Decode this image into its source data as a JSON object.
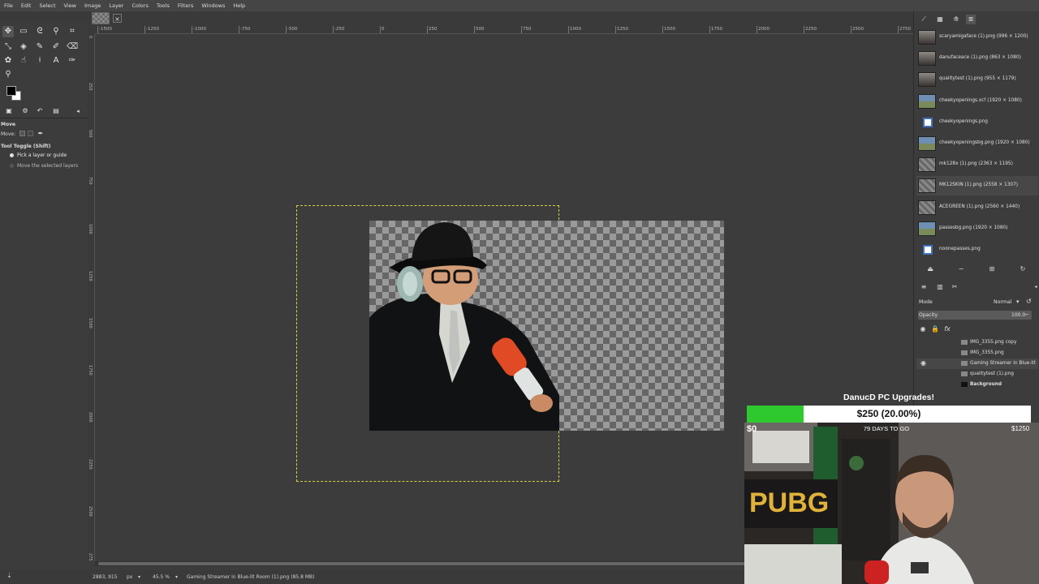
{
  "menu": [
    "File",
    "Edit",
    "Select",
    "View",
    "Image",
    "Layer",
    "Colors",
    "Tools",
    "Filters",
    "Windows",
    "Help"
  ],
  "tool_options": {
    "title": "Move",
    "move_label": "Move:",
    "toggle_label": "Tool Toggle  (Shift)",
    "opt1": "Pick a layer or guide",
    "opt2": "Move the selected layers"
  },
  "ruler": {
    "top_ticks": [
      "-1500",
      "-1250",
      "-1000",
      "-750",
      "-500",
      "-250",
      "0",
      "250",
      "500",
      "750",
      "1000",
      "1250",
      "1500",
      "1750",
      "2000",
      "2250",
      "2500",
      "2750"
    ],
    "left_ticks": [
      "0",
      "250",
      "500",
      "750",
      "1000",
      "1250",
      "1500",
      "1750",
      "2000",
      "2250",
      "2500",
      "2750"
    ]
  },
  "status": {
    "coords": "2883, 915",
    "unit": "px",
    "zoom": "45.5 %",
    "message": "Gaming Streamer in Blue-lit Room (1).png (85.8 MB)"
  },
  "images": [
    {
      "name": "scaryamigaface (1).png (996 × 1200)",
      "thumb": "portrait"
    },
    {
      "name": "danufaceace (1).png (863 × 1080)",
      "thumb": "portrait"
    },
    {
      "name": "qualitytest (1).png (955 × 1179)",
      "thumb": "portrait"
    },
    {
      "name": "cheekyopenings.xcf (1920 × 1080)",
      "thumb": "scene"
    },
    {
      "name": "cheekyopenings.png",
      "thumb": "icon"
    },
    {
      "name": "cheekyopeningsbg.png (1920 × 1080)",
      "thumb": "scene"
    },
    {
      "name": "mk128x (1).png (2363 × 1195)",
      "thumb": "grey"
    },
    {
      "name": "MK12SKIN (1).png (2558 × 1307)",
      "thumb": "grey"
    },
    {
      "name": "ACEGREEN (1).png (2560 × 1440)",
      "thumb": "grey"
    },
    {
      "name": "passesbg.png (1920 × 1080)",
      "thumb": "scene"
    },
    {
      "name": "noonepasses.png",
      "thumb": "icon"
    }
  ],
  "layers_panel": {
    "mode_label": "Mode",
    "mode_value": "Normal",
    "opacity_label": "Opacity",
    "opacity_value": "100.0",
    "layers": [
      {
        "name": "IMG_3355.png copy",
        "visible": false
      },
      {
        "name": "IMG_3355.png",
        "visible": false
      },
      {
        "name": "Gaming Streamer in Blue-lit",
        "visible": true
      },
      {
        "name": "qualitytest (1).png",
        "visible": false
      },
      {
        "name": "Background",
        "visible": false
      }
    ]
  },
  "donation_goal": {
    "title": "DanucD PC Upgrades!",
    "amount": "$250 (20.00%)",
    "progress": 0.2,
    "min": "$0",
    "max": "$1250",
    "days": "79 DAYS TO GO"
  },
  "colors": {
    "accent_green": "#2ec92e",
    "layer_boundary": "#d6d04a",
    "panel": "#3c3c3c"
  }
}
